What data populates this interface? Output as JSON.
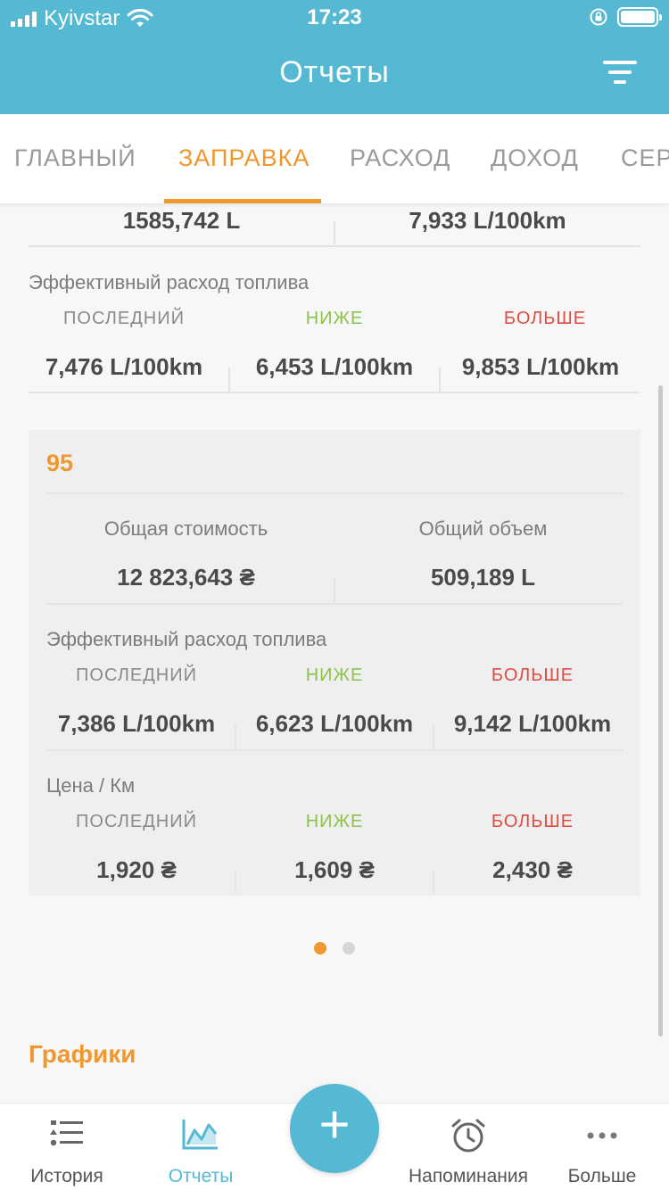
{
  "status_bar": {
    "carrier": "Kyivstar",
    "time": "17:23"
  },
  "nav": {
    "title": "Отчеты"
  },
  "tabs": [
    "ГЛАВНЫЙ",
    "ЗАПРАВКА",
    "РАСХОД",
    "ДОХОД",
    "СЕР"
  ],
  "active_tab": "ЗАПРАВКА",
  "summary_top": {
    "volume": "1585,742 L",
    "avg_consumption": "7,933 L/100km"
  },
  "effective": {
    "label": "Эффективный расход топлива",
    "headers": [
      "ПОСЛЕДНИЙ",
      "НИЖЕ",
      "БОЛЬШЕ"
    ],
    "values": [
      "7,476 L/100km",
      "6,453 L/100km",
      "9,853 L/100km"
    ]
  },
  "fuel_card": {
    "title": "95",
    "total_cost_label": "Общая стоимость",
    "total_volume_label": "Общий объем",
    "total_cost": "12 823,643 ₴",
    "total_volume": "509,189 L",
    "effective_label": "Эффективный расход топлива",
    "headers": [
      "ПОСЛЕДНИЙ",
      "НИЖЕ",
      "БОЛЬШЕ"
    ],
    "effective_values": [
      "7,386 L/100km",
      "6,623 L/100km",
      "9,142 L/100km"
    ],
    "price_label": "Цена / Км",
    "price_values": [
      "1,920 ₴",
      "1,609 ₴",
      "2,430 ₴"
    ]
  },
  "pager": {
    "count": 2,
    "active": 0
  },
  "charts_section": {
    "title": "Графики"
  },
  "tabbar": {
    "items": [
      {
        "label": "История",
        "icon": "list-icon"
      },
      {
        "label": "Отчеты",
        "icon": "chart-icon"
      },
      {
        "label": "Напоминания",
        "icon": "alarm-clock-icon"
      },
      {
        "label": "Больше",
        "icon": "more-dots-icon"
      }
    ],
    "fab_symbol": "+"
  },
  "colors": {
    "primary": "#56b9d3",
    "accent": "#f0982f",
    "green": "#8bc34a",
    "red": "#e04a3f"
  }
}
